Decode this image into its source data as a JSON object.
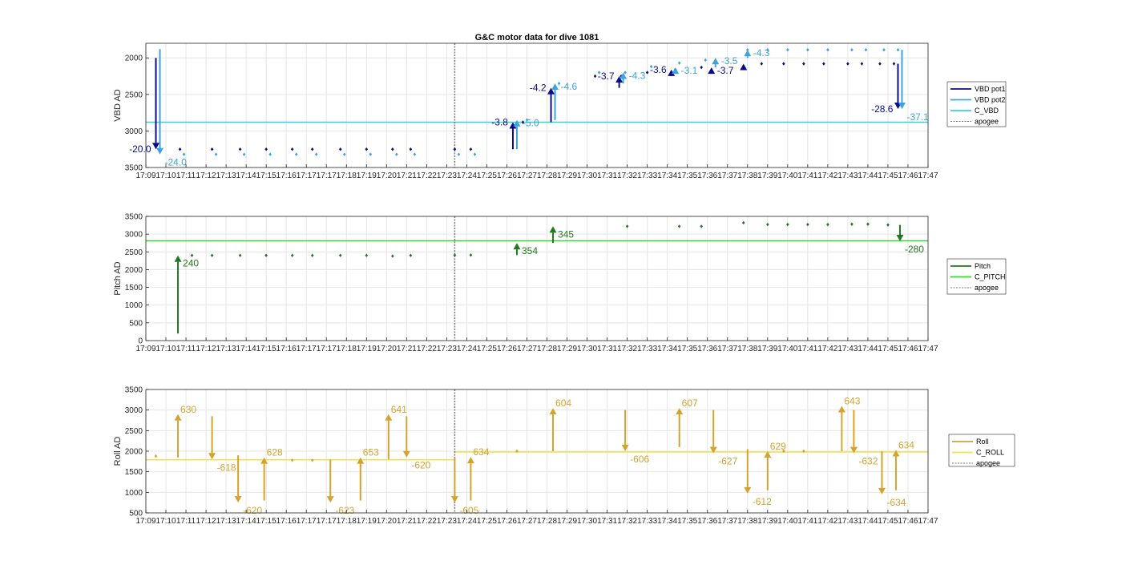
{
  "chart_data": [
    {
      "type": "line",
      "title": "G&C motor data for dive 1081",
      "xlabel": "",
      "ylabel": "VBD AD",
      "ylim": [
        1800,
        3500
      ],
      "y_reversed": true,
      "yticks": [
        2000,
        2500,
        3000,
        3500
      ],
      "grid": true,
      "legend_position": "outside-right",
      "x_tick_labels": [
        "17:09",
        "17:10",
        "17:11",
        "17:12",
        "17:13",
        "17:14",
        "17:15",
        "17:16",
        "17:17",
        "17:17",
        "17:18",
        "17:19",
        "17:20",
        "17:21",
        "17:22",
        "17:23",
        "17:24",
        "17:25",
        "17:26",
        "17:27",
        "17:28",
        "17:29",
        "17:30",
        "17:31",
        "17:32",
        "17:33",
        "17:34",
        "17:35",
        "17:36",
        "17:37",
        "17:38",
        "17:39",
        "17:40",
        "17:41",
        "17:42",
        "17:43",
        "17:44",
        "17:45",
        "17:46",
        "17:47"
      ],
      "apogee_x": 15.4,
      "series": [
        {
          "name": "VBD pot1",
          "color": "#0b0b8a",
          "kind": "points",
          "x": [
            1.7,
            3.3,
            4.7,
            6.0,
            7.3,
            8.3,
            9.7,
            11.0,
            12.3,
            13.2,
            15.4,
            16.2,
            18.8,
            20.4,
            22.4,
            23.7,
            25.0,
            26.4,
            27.7,
            29.8,
            30.7,
            31.8,
            32.8,
            33.8,
            35.0,
            35.7,
            36.6,
            37.3
          ],
          "y": [
            3250,
            3250,
            3250,
            3250,
            3250,
            3250,
            3250,
            3250,
            3250,
            3250,
            3250,
            3250,
            2880,
            2410,
            2250,
            2250,
            2200,
            2160,
            2130,
            2120,
            2080,
            2080,
            2080,
            2080,
            2080,
            2080,
            2080,
            2080
          ]
        },
        {
          "name": "VBD pot2",
          "color": "#3ba4e0",
          "kind": "points",
          "x": [
            1.9,
            3.5,
            4.9,
            6.2,
            7.5,
            8.5,
            9.9,
            11.2,
            12.5,
            13.4,
            15.6,
            16.4,
            19.0,
            20.6,
            22.6,
            23.9,
            25.2,
            26.6,
            27.9,
            30.0,
            31.0,
            32.0,
            33.0,
            34.0,
            35.2,
            35.9,
            36.8,
            37.5
          ],
          "y": [
            3320,
            3320,
            3320,
            3320,
            3320,
            3320,
            3320,
            3320,
            3320,
            3320,
            3320,
            3320,
            2850,
            2350,
            2200,
            2200,
            2120,
            2070,
            2030,
            1890,
            1890,
            1890,
            1890,
            1890,
            1890,
            1890,
            1890,
            1890
          ]
        },
        {
          "name": "C_VBD",
          "color": "#3ad0d8",
          "kind": "hline",
          "y": 2880
        },
        {
          "name": "apogee",
          "color": "#7a7a7a",
          "kind": "vline",
          "x": 15.4
        }
      ],
      "arrows": [
        {
          "x": 0.5,
          "from": 2000,
          "to": 3250,
          "color": "#0b0b8a",
          "label": "-20.0",
          "label_side": "left"
        },
        {
          "x": 0.7,
          "from": 1880,
          "to": 3320,
          "color": "#3ba4e0",
          "label": "-24.0",
          "label_side": "right-below"
        },
        {
          "x": 18.3,
          "from": 3250,
          "to": 2880,
          "color": "#0b0b8a",
          "label": "-3.8",
          "label_side": "left"
        },
        {
          "x": 18.5,
          "from": 3250,
          "to": 2850,
          "color": "#3ba4e0",
          "label": "-5.0",
          "label_side": "right"
        },
        {
          "x": 20.2,
          "from": 2880,
          "to": 2410,
          "color": "#0b0b8a",
          "label": "-4.2",
          "label_side": "left"
        },
        {
          "x": 20.4,
          "from": 2850,
          "to": 2350,
          "color": "#3ba4e0",
          "label": "-4.6",
          "label_side": "right"
        },
        {
          "x": 23.6,
          "from": 2410,
          "to": 2250,
          "color": "#0b0b8a",
          "label": "-3.7",
          "label_side": "left"
        },
        {
          "x": 23.8,
          "from": 2350,
          "to": 2200,
          "color": "#3ba4e0",
          "label": "-4.3",
          "label_side": "right"
        },
        {
          "x": 26.2,
          "from": 2250,
          "to": 2160,
          "color": "#0b0b8a",
          "label": "-3.6",
          "label_side": "left"
        },
        {
          "x": 26.4,
          "from": 2200,
          "to": 2130,
          "color": "#3ba4e0",
          "label": "-3.1",
          "label_side": "right"
        },
        {
          "x": 28.2,
          "from": 2160,
          "to": 2130,
          "color": "#0b0b8a",
          "label": "-3.7",
          "label_side": "right"
        },
        {
          "x": 28.4,
          "from": 2130,
          "to": 2000,
          "color": "#3ba4e0",
          "label": "-3.5",
          "label_side": "right"
        },
        {
          "x": 29.8,
          "from": 2130,
          "to": 2080,
          "color": "#0b0b8a",
          "label": "",
          "label_side": "right"
        },
        {
          "x": 30.0,
          "from": 2000,
          "to": 1890,
          "color": "#3ba4e0",
          "label": "-4.3",
          "label_side": "right"
        },
        {
          "x": 37.5,
          "from": 2080,
          "to": 2700,
          "color": "#0b0b8a",
          "label": "-28.6",
          "label_side": "left"
        },
        {
          "x": 37.7,
          "from": 1890,
          "to": 2700,
          "color": "#3ba4e0",
          "label": "-37.1",
          "label_side": "right-below"
        }
      ]
    },
    {
      "type": "line",
      "title": "",
      "xlabel": "",
      "ylabel": "Pitch AD",
      "ylim": [
        0,
        3500
      ],
      "yticks": [
        0,
        500,
        1000,
        1500,
        2000,
        2500,
        3000,
        3500
      ],
      "grid": true,
      "legend_position": "outside-right",
      "apogee_x": 15.4,
      "series": [
        {
          "name": "Pitch",
          "color": "#1f7a1f",
          "kind": "points",
          "x": [
            2.3,
            3.3,
            4.7,
            6.0,
            7.3,
            8.3,
            9.7,
            11.0,
            12.3,
            13.2,
            15.4,
            16.2,
            24.0,
            26.6,
            27.7,
            29.8,
            31.0,
            32.0,
            33.0,
            34.0,
            35.2,
            36.0,
            37.0
          ],
          "y": [
            2400,
            2400,
            2400,
            2400,
            2400,
            2400,
            2400,
            2400,
            2380,
            2400,
            2410,
            2410,
            3220,
            3220,
            3220,
            3320,
            3270,
            3270,
            3270,
            3270,
            3280,
            3280,
            3260
          ]
        },
        {
          "name": "C_PITCH",
          "color": "#33d633",
          "kind": "hline",
          "y": 2810
        },
        {
          "name": "apogee",
          "color": "#7a7a7a",
          "kind": "vline",
          "x": 15.4
        }
      ],
      "arrows": [
        {
          "x": 1.6,
          "from": 200,
          "to": 2400,
          "color": "#1f7a1f",
          "label": "240",
          "label_side": "right-below"
        },
        {
          "x": 18.5,
          "from": 2410,
          "to": 2750,
          "color": "#1f7a1f",
          "label": "354",
          "label_side": "right-below"
        },
        {
          "x": 20.3,
          "from": 2750,
          "to": 3220,
          "color": "#1f7a1f",
          "label": "345",
          "label_side": "right-below"
        },
        {
          "x": 37.6,
          "from": 3260,
          "to": 2800,
          "color": "#1f7a1f",
          "label": "-280",
          "label_side": "right-below"
        }
      ]
    },
    {
      "type": "line",
      "title": "",
      "xlabel": "",
      "ylabel": "Roll AD",
      "ylim": [
        500,
        3500
      ],
      "yticks": [
        500,
        1000,
        1500,
        2000,
        2500,
        3000,
        3500
      ],
      "grid": true,
      "legend_position": "outside-right",
      "apogee_x": 15.4,
      "series": [
        {
          "name": "Roll",
          "color": "#d4a32e",
          "kind": "points",
          "x": [
            0.5,
            7.3,
            8.3,
            18.5,
            31.8,
            32.8
          ],
          "y": [
            1880,
            1780,
            1780,
            2000,
            2000,
            2000
          ]
        },
        {
          "name": "C_ROLL",
          "color": "#f2e14c",
          "kind": "hline",
          "y_left": 1790,
          "y_right": 1980,
          "break_x": 15.4
        },
        {
          "name": "apogee",
          "color": "#7a7a7a",
          "kind": "vline",
          "x": 15.4
        }
      ],
      "arrows": [
        {
          "x": 1.6,
          "from": 1850,
          "to": 2900,
          "color": "#d4a32e",
          "label": "630",
          "label_side": "right-above"
        },
        {
          "x": 3.3,
          "from": 2850,
          "to": 1800,
          "color": "#d4a32e",
          "label": "-618",
          "label_side": "right-below"
        },
        {
          "x": 4.6,
          "from": 1900,
          "to": 750,
          "color": "#d4a32e",
          "label": "-620",
          "label_side": "right-below"
        },
        {
          "x": 5.9,
          "from": 800,
          "to": 1850,
          "color": "#d4a32e",
          "label": "628",
          "label_side": "right-above"
        },
        {
          "x": 9.2,
          "from": 1800,
          "to": 750,
          "color": "#d4a32e",
          "label": "-623",
          "label_side": "right-below"
        },
        {
          "x": 10.7,
          "from": 800,
          "to": 1850,
          "color": "#d4a32e",
          "label": "653",
          "label_side": "right-above"
        },
        {
          "x": 12.1,
          "from": 1800,
          "to": 2900,
          "color": "#d4a32e",
          "label": "641",
          "label_side": "right-above"
        },
        {
          "x": 13.0,
          "from": 2850,
          "to": 1850,
          "color": "#d4a32e",
          "label": "-620",
          "label_side": "right-below"
        },
        {
          "x": 15.4,
          "from": 1850,
          "to": 750,
          "color": "#d4a32e",
          "label": "-605",
          "label_side": "right-below"
        },
        {
          "x": 16.2,
          "from": 800,
          "to": 1860,
          "color": "#d4a32e",
          "label": "634",
          "label_side": "right-above"
        },
        {
          "x": 20.3,
          "from": 2000,
          "to": 3050,
          "color": "#d4a32e",
          "label": "604",
          "label_side": "right-above"
        },
        {
          "x": 23.9,
          "from": 3000,
          "to": 2000,
          "color": "#d4a32e",
          "label": "-606",
          "label_side": "right-below"
        },
        {
          "x": 26.6,
          "from": 2100,
          "to": 3050,
          "color": "#d4a32e",
          "label": "607",
          "label_side": "right-above"
        },
        {
          "x": 28.3,
          "from": 3000,
          "to": 1950,
          "color": "#d4a32e",
          "label": "-627",
          "label_side": "right-below"
        },
        {
          "x": 30.0,
          "from": 2050,
          "to": 970,
          "color": "#d4a32e",
          "label": "-612",
          "label_side": "right-below"
        },
        {
          "x": 31.0,
          "from": 1050,
          "to": 2000,
          "color": "#d4a32e",
          "label": "629",
          "label_side": "right-above"
        },
        {
          "x": 34.7,
          "from": 2000,
          "to": 3100,
          "color": "#d4a32e",
          "label": "643",
          "label_side": "right-above"
        },
        {
          "x": 35.3,
          "from": 3000,
          "to": 1950,
          "color": "#d4a32e",
          "label": "-632",
          "label_side": "right-below"
        },
        {
          "x": 36.7,
          "from": 2000,
          "to": 950,
          "color": "#d4a32e",
          "label": "-634",
          "label_side": "right-below"
        },
        {
          "x": 37.4,
          "from": 1050,
          "to": 2030,
          "color": "#d4a32e",
          "label": "634",
          "label_side": "right-above"
        }
      ]
    }
  ]
}
